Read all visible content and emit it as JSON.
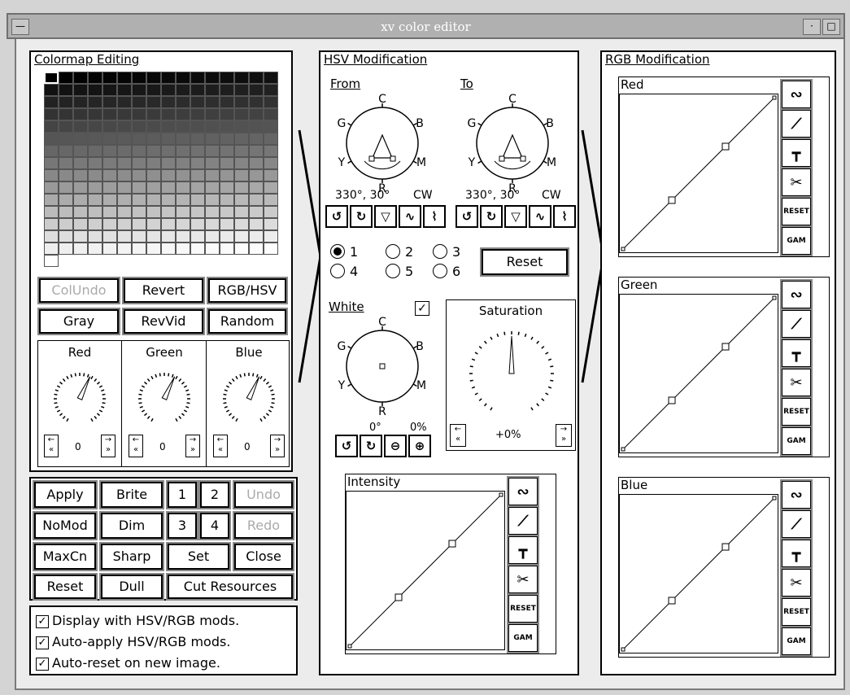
{
  "window": {
    "title": "xv color editor"
  },
  "colormap": {
    "title": "Colormap Editing",
    "buttons": [
      "ColUndo",
      "Revert",
      "RGB/HSV",
      "Gray",
      "RevVid",
      "Random"
    ],
    "dials": [
      {
        "label": "Red",
        "value": "0"
      },
      {
        "label": "Green",
        "value": "0"
      },
      {
        "label": "Blue",
        "value": "0"
      }
    ]
  },
  "actions": {
    "rows": [
      [
        "Apply",
        "Brite",
        "1",
        "2",
        "Undo"
      ],
      [
        "NoMod",
        "Dim",
        "3",
        "4",
        "Redo"
      ],
      [
        "MaxCn",
        "Sharp",
        "Set",
        "Close"
      ],
      [
        "Reset",
        "Dull",
        "Cut Resources"
      ]
    ]
  },
  "options": [
    {
      "label": "Display with HSV/RGB mods.",
      "checked": true
    },
    {
      "label": "Auto-apply HSV/RGB mods.",
      "checked": true
    },
    {
      "label": "Auto-reset on new image.",
      "checked": true
    }
  ],
  "hsv": {
    "title": "HSV Modification",
    "from": {
      "label": "From",
      "readout": "330°, 30°",
      "dir": "CW"
    },
    "to": {
      "label": "To",
      "readout": "330°, 30°",
      "dir": "CW"
    },
    "wheel_labels": {
      "c": "C",
      "g": "G",
      "b": "B",
      "y": "Y",
      "m": "M",
      "r": "R"
    },
    "radios": [
      {
        "label": "1",
        "checked": true
      },
      {
        "label": "2",
        "checked": false
      },
      {
        "label": "3",
        "checked": false
      },
      {
        "label": "4",
        "checked": false
      },
      {
        "label": "5",
        "checked": false
      },
      {
        "label": "6",
        "checked": false
      }
    ],
    "reset_label": "Reset",
    "white": {
      "label": "White",
      "readout_deg": "0°",
      "readout_pct": "0%"
    },
    "saturation": {
      "label": "Saturation",
      "value": "+0%"
    },
    "intensity": {
      "label": "Intensity"
    }
  },
  "rgb": {
    "title": "RGB Modification",
    "graphs": [
      {
        "label": "Red"
      },
      {
        "label": "Green"
      },
      {
        "label": "Blue"
      }
    ]
  },
  "graph_buttons": {
    "reset": "RESET",
    "gam": "GAM"
  },
  "colors": {
    "window_bg": "#ececec",
    "titlebar": "#b0b0b0",
    "panel": "#ffffff"
  }
}
